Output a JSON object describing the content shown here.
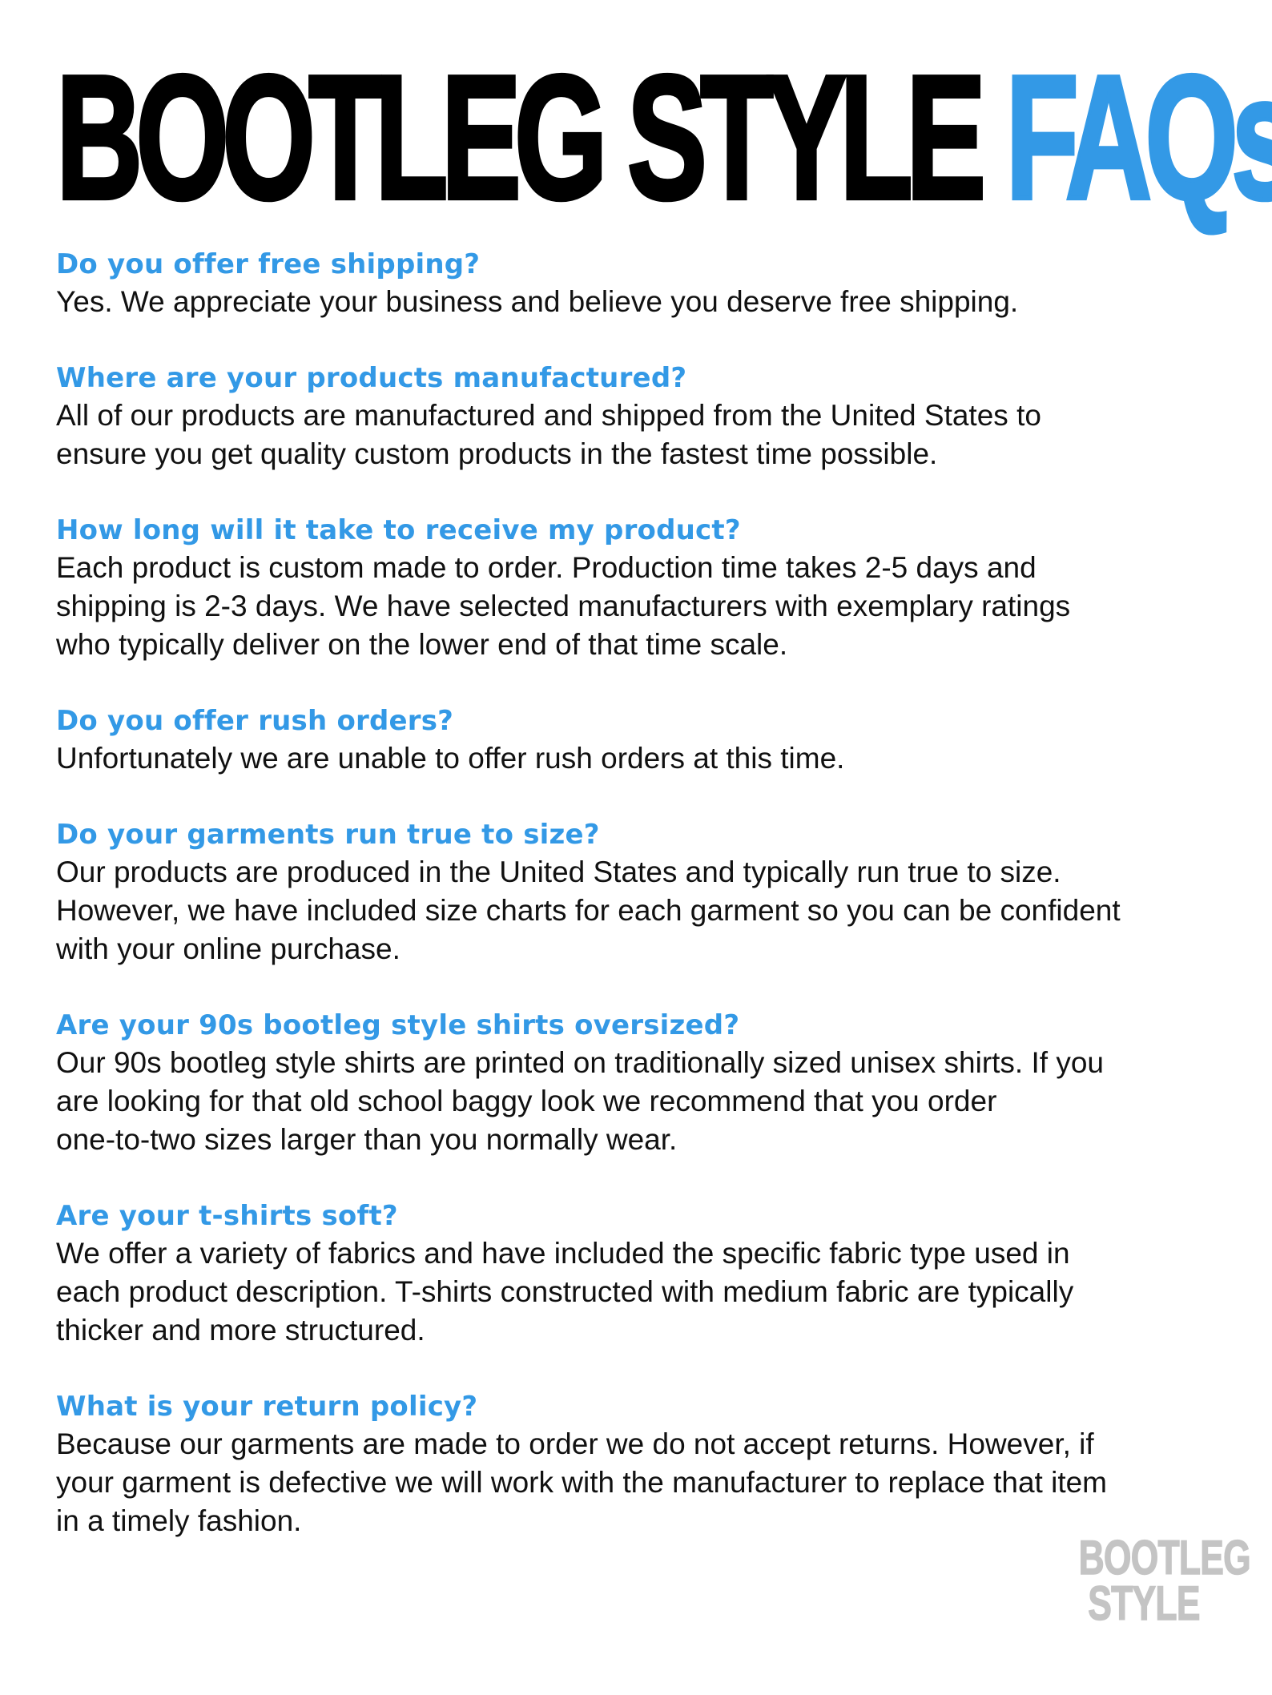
{
  "title": {
    "main": "BOOTLEG STYLE ",
    "accent": "FAQs"
  },
  "colors": {
    "accent": "#3399e6",
    "body_text": "#111111",
    "logo": "#c4c4c4"
  },
  "faqs": [
    {
      "question": "Do you offer free shipping?",
      "answer": "Yes. We appreciate your business and believe you deserve free shipping."
    },
    {
      "question": "Where are your products manufactured?",
      "answer": "All of our products are manufactured and shipped from the United States to\nensure you get quality custom products in the fastest time possible."
    },
    {
      "question": "How long will it take to receive my product?",
      "answer": "Each product is custom made to order. Production time takes 2-5 days and\nshipping is 2-3 days. We have selected manufacturers with exemplary ratings\nwho typically deliver on the lower end of that time scale."
    },
    {
      "question": "Do you offer rush orders?",
      "answer": "Unfortunately we are unable to offer rush orders at this time."
    },
    {
      "question": "Do your garments run true to size?",
      "answer": "Our products are produced in the United States and typically run true to size.\nHowever, we have included size charts for each garment so you can be confident\nwith your online purchase."
    },
    {
      "question": "Are your 90s bootleg style shirts oversized?",
      "answer": "Our 90s bootleg style shirts are printed on traditionally sized unisex shirts. If you\nare looking for that old school baggy look we recommend that you order\none-to-two sizes larger than you normally wear."
    },
    {
      "question": "Are your t-shirts soft?",
      "answer": "We offer a variety of fabrics and have included the specific fabric type used in\neach product description. T-shirts constructed with medium fabric are typically\nthicker and more structured."
    },
    {
      "question": "What is your return policy?",
      "answer": "Because our garments are made to order we do not accept returns. However, if\nyour garment is defective we will work with the manufacturer to replace that item\nin a timely fashion."
    }
  ],
  "logo": {
    "line1": "BOOTLEG",
    "line2": "STYLE"
  }
}
